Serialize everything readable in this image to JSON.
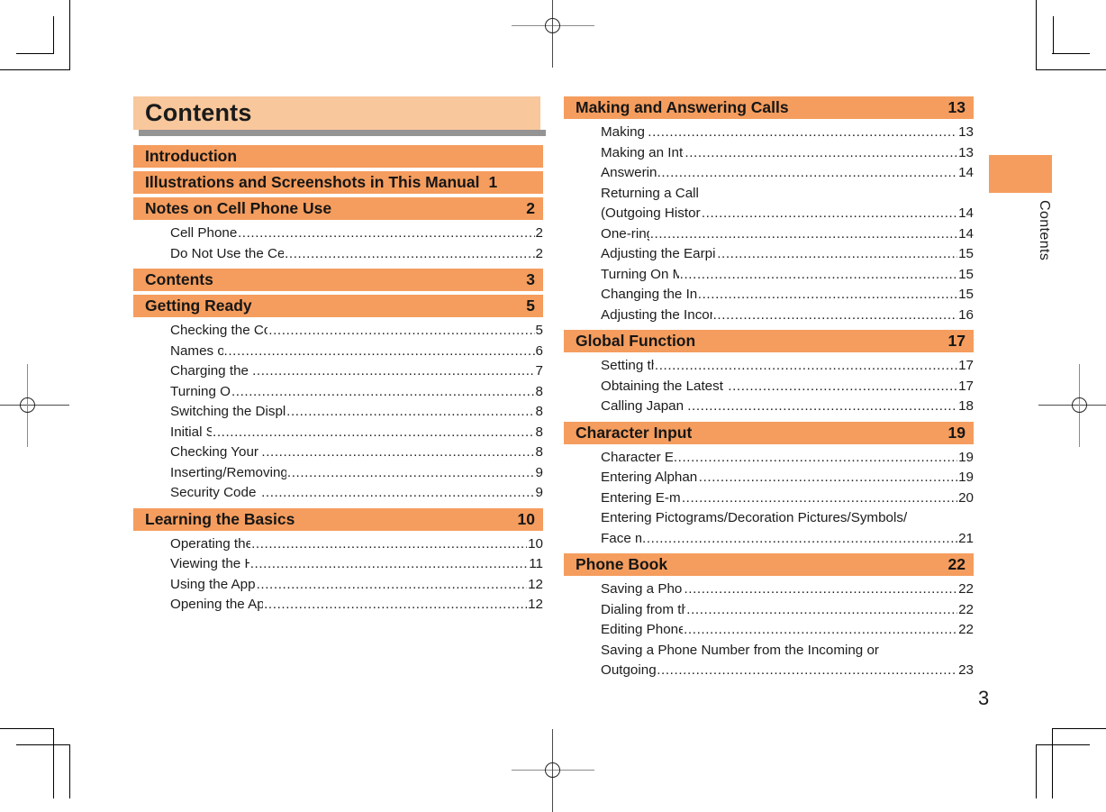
{
  "document": {
    "title": "Contents",
    "page_number": "3",
    "side_tab_label": "Contents",
    "accent_color": "#f59d5e",
    "title_bar_color": "#f8c79b",
    "title_shadow_color": "#949494",
    "leader_dots": "................................................................................................................................"
  },
  "left_column": [
    {
      "label": "Introduction",
      "page": "",
      "tight": false,
      "entries": []
    },
    {
      "label": "Illustrations and Screenshots in This Manual",
      "page": "1",
      "tight": true,
      "entries": []
    },
    {
      "label": "Notes on Cell Phone Use",
      "page": "2",
      "tight": false,
      "entries": [
        {
          "label": "Cell Phone Etiquette",
          "page": "2",
          "cont": false,
          "gap": false
        },
        {
          "label": "Do Not Use the Cell Phone While Driving!",
          "page": "2",
          "cont": false,
          "gap": true
        }
      ]
    },
    {
      "label": "Contents",
      "page": "3",
      "tight": false,
      "entries": []
    },
    {
      "label": "Getting Ready",
      "page": "5",
      "tight": false,
      "entries": [
        {
          "label": "Checking the Contents of the Box",
          "page": "5",
          "cont": false,
          "gap": true
        },
        {
          "label": "Names of Parts",
          "page": "6",
          "cont": false,
          "gap": false
        },
        {
          "label": "Charging the Battery Pack",
          "page": "7",
          "cont": false,
          "gap": false
        },
        {
          "label": "Turning On Power",
          "page": "8",
          "cont": false,
          "gap": false
        },
        {
          "label": "Switching the Display Language to English",
          "page": "8",
          "cont": false,
          "gap": false
        },
        {
          "label": "Initial Setup",
          "page": "8",
          "cont": false,
          "gap": false
        },
        {
          "label": "Checking Your Phone Number",
          "page": "8",
          "cont": false,
          "gap": false
        },
        {
          "label": "Inserting/Removing microSD Memory Card",
          "page": "9",
          "cont": false,
          "gap": false
        },
        {
          "label": "Security Code and Passwords",
          "page": "9",
          "cont": false,
          "gap": true
        }
      ]
    },
    {
      "label": "Learning the Basics",
      "page": "10",
      "tight": false,
      "entries": [
        {
          "label": "Operating the Touch Panel",
          "page": "10",
          "cont": false,
          "gap": true
        },
        {
          "label": "Viewing the Home Screen",
          "page": "11",
          "cont": false,
          "gap": false
        },
        {
          "label": "Using the Application Screen",
          "page": "12",
          "cont": false,
          "gap": true
        },
        {
          "label": "Opening the Applications screen",
          "page": "12",
          "cont": false,
          "gap": false
        }
      ]
    }
  ],
  "right_column": [
    {
      "label": "Making and Answering Calls",
      "page": "13",
      "tight": false,
      "entries": [
        {
          "label": "Making a Call",
          "page": "13",
          "cont": false,
          "gap": false
        },
        {
          "label": "Making an International Call",
          "page": "13",
          "cont": false,
          "gap": false
        },
        {
          "label": "Answering a Call",
          "page": "14",
          "cont": false,
          "gap": true
        },
        {
          "label": "Returning a Call",
          "page": "",
          "cont": true,
          "gap": false
        },
        {
          "label": "(Outgoing History/Incoming History)",
          "page": "14",
          "cont": false,
          "gap": true
        },
        {
          "label": "One-ring Calls",
          "page": "14",
          "cont": false,
          "gap": true
        },
        {
          "label": "Adjusting the Earpiece Volume during a Call",
          "page": "15",
          "cont": false,
          "gap": true
        },
        {
          "label": "Turning On Manner Mode",
          "page": "15",
          "cont": false,
          "gap": false
        },
        {
          "label": "Changing the Incoming Ring Tone",
          "page": "15",
          "cont": false,
          "gap": true
        },
        {
          "label": "Adjusting the Incoming Ring Tone Volume",
          "page": "16",
          "cont": false,
          "gap": true
        }
      ]
    },
    {
      "label": "Global Function",
      "page": "17",
      "tight": false,
      "entries": [
        {
          "label": "Setting the Area",
          "page": "17",
          "cont": false,
          "gap": false
        },
        {
          "label": "Obtaining the Latest PRL (Preferred Roaming List)",
          "page": "17",
          "cont": false,
          "gap": false
        },
        {
          "label": "Calling Japan from Overseas",
          "page": "18",
          "cont": false,
          "gap": true
        }
      ]
    },
    {
      "label": "Character Input",
      "page": "19",
      "tight": false,
      "entries": [
        {
          "label": "Character Entry Modes",
          "page": "19",
          "cont": false,
          "gap": true
        },
        {
          "label": "Entering Alphanumeric Characters",
          "page": "19",
          "cont": false,
          "gap": true
        },
        {
          "label": "Entering E-mail Addresses",
          "page": "20",
          "cont": false,
          "gap": false
        },
        {
          "label": "Entering Pictograms/Decoration Pictures/Symbols/",
          "page": "",
          "cont": true,
          "gap": false
        },
        {
          "label": "Face marks",
          "page": "21",
          "cont": false,
          "gap": false
        }
      ]
    },
    {
      "label": "Phone Book",
      "page": "22",
      "tight": false,
      "entries": [
        {
          "label": "Saving a Phone Book Entry",
          "page": "22",
          "cont": false,
          "gap": true
        },
        {
          "label": "Dialing from the Phone Book",
          "page": "22",
          "cont": false,
          "gap": false
        },
        {
          "label": "Editing Phone Book Entries",
          "page": "22",
          "cont": false,
          "gap": false
        },
        {
          "label": "Saving a Phone Number from the Incoming or",
          "page": "",
          "cont": true,
          "gap": false
        },
        {
          "label": "Outgoing History",
          "page": "23",
          "cont": false,
          "gap": true
        }
      ]
    }
  ]
}
